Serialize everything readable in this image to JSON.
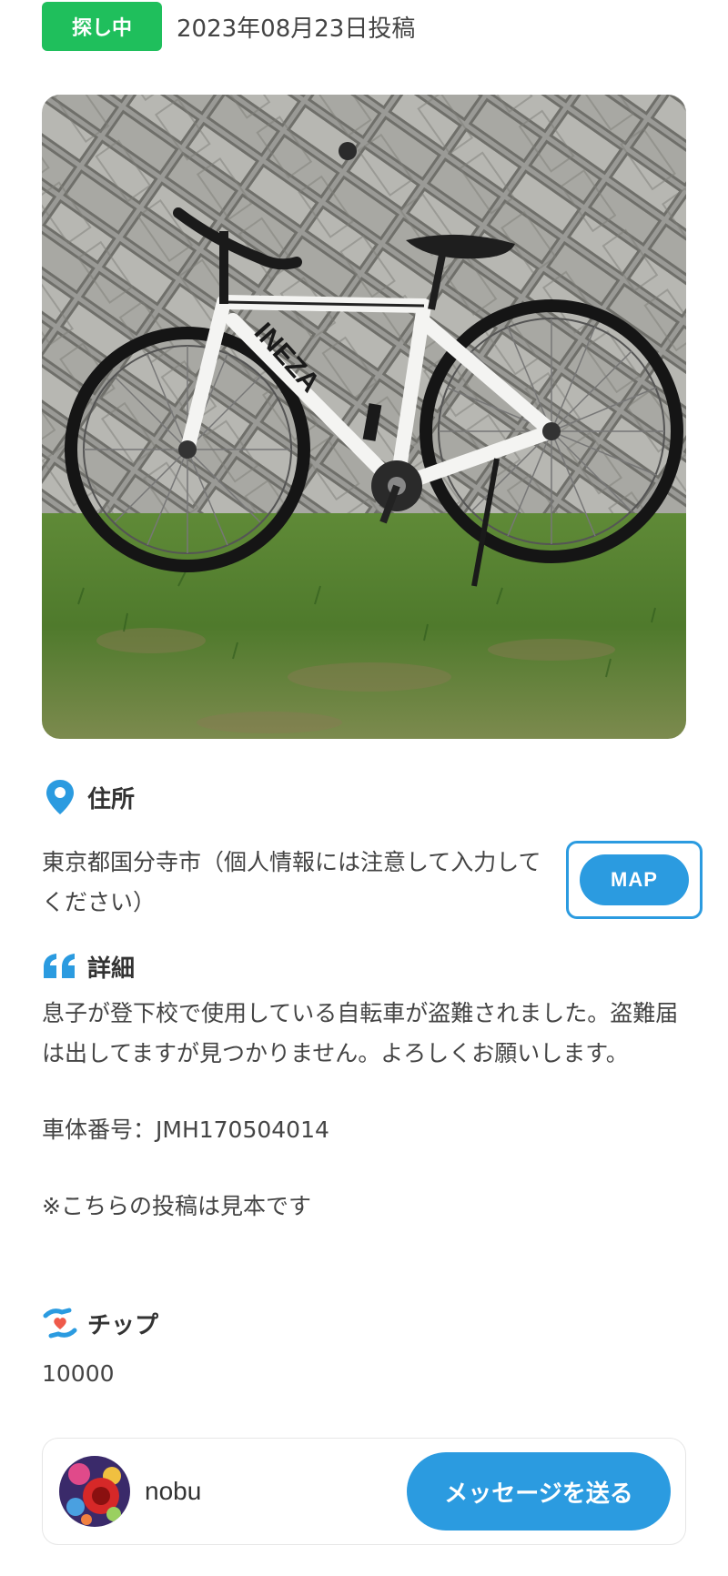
{
  "status": {
    "badge": "探し中",
    "date": "2023年08月23日投稿"
  },
  "photo": {
    "icon": "bicycle-photo",
    "frame_text": "INEZA"
  },
  "address": {
    "title": "住所",
    "icon": "location-pin-icon",
    "text": "東京都国分寺市（個人情報には注意して入力してください）",
    "map_button": "MAP"
  },
  "detail": {
    "title": "詳細",
    "icon": "quote-icon",
    "paragraphs": [
      "息子が登下校で使用している自転車が盗難されました。盗難届は出してますが見つかりません。よろしくお願いします。",
      "車体番号：JMH170504014",
      "※こちらの投稿は見本です"
    ]
  },
  "tip": {
    "title": "チップ",
    "icon": "hand-heart-icon",
    "value": "10000"
  },
  "user": {
    "name": "nobu",
    "message_button": "メッセージを送る"
  },
  "colors": {
    "accent": "#2b9be0",
    "status_green": "#1fbf5c",
    "text": "#333333"
  }
}
